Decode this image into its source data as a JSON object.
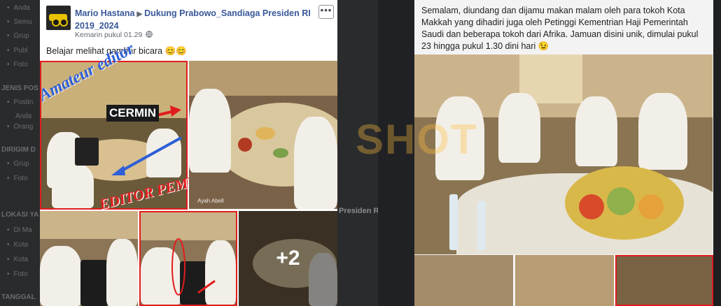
{
  "post": {
    "author": "Mario Hastana",
    "group": "Dukung Prabowo_Sandiaga Presiden RI 2019_2024",
    "timestamp": "Kemarin pukul 01.29",
    "privacy_icon": "globe-icon",
    "text": "Belajar melihat gambar bicara 😊😊",
    "more_label": "•••",
    "more_photos": "+2"
  },
  "photo_overlays": {
    "amateur": "Amateur editor",
    "cermin": "CERMIN",
    "editor_pemula": "EDITOR PEMUL",
    "watermark": "Ayah Abell"
  },
  "background_page": {
    "sections": [
      "JENIS POS",
      "DIRIGIM D",
      "LOKASI YA",
      "TANGGAL"
    ],
    "items": [
      "Anda",
      "Semu",
      "Grup",
      "Publ",
      "Foto",
      "Postin",
      "Anda",
      "Orang",
      "Grup",
      "Foto",
      "Di Ma",
      "Kota",
      "Kota",
      "Foto"
    ],
    "partial_label": "Presiden R"
  },
  "right_post": {
    "caption": "Semalam, diundang dan dijamu makan malam oleh para tokoh Kota Makkah yang dihadiri juga oleh Petinggi Kementrian Haji Pemerintah Saudi dan beberapa tokoh dari Afrika. Jamuan disini unik, dimulai pukul 23 hingga pukul 1.30 dini hari 😉"
  },
  "watermark_center": "SHOT",
  "colors": {
    "link": "#385898",
    "highlight_red": "#e01d1d",
    "annotation_blue": "#2f5fd6"
  }
}
